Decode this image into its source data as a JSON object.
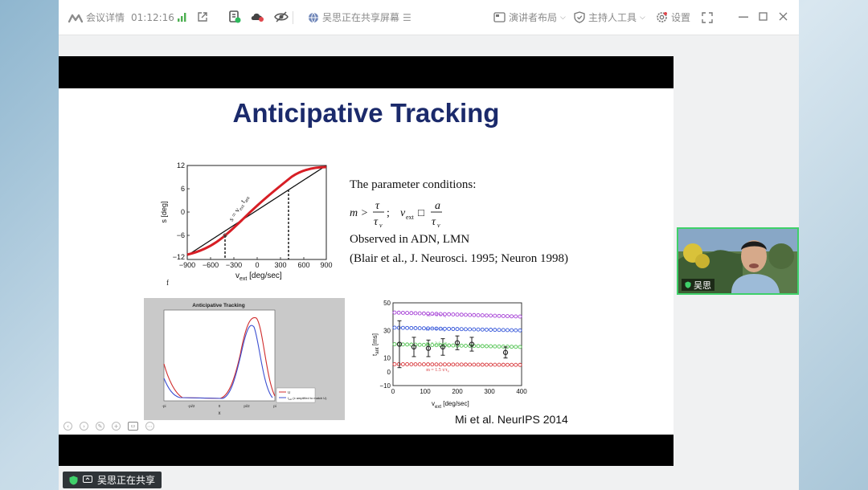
{
  "topbar": {
    "meeting_info_label": "会议详情",
    "timer": "01:12:16",
    "sharing_status": "吴思正在共享屏幕",
    "presenter_layout_label": "演讲者布局",
    "host_tools_label": "主持人工具",
    "settings_label": "设置"
  },
  "slide": {
    "title": "Anticipative Tracking",
    "param_heading": "The parameter conditions:",
    "formula_m": "m >",
    "formula_tau": "τ",
    "formula_tau_v": "τ",
    "formula_sub_v": "v",
    "formula_semicolon": ";",
    "formula_vext": "v",
    "formula_sub_ext": "ext",
    "formula_box": "□",
    "formula_a": "a",
    "formula_tau_v2": "τ",
    "formula_sub_v2": "v",
    "observed": "Observed in ADN, LMN",
    "refs": "(Blair et al., J. Neurosci. 1995; Neuron 1998)",
    "citation": "Mi et al. NeurIPS 2014"
  },
  "chart_top": {
    "y_label": "s [deg]",
    "x_label_main": "v",
    "x_label_sub": "ext",
    "x_label_unit": "[deg/sec]",
    "line_annotation": "s = v",
    "line_annotation_sub": "ext",
    "line_annotation_tail": "t",
    "line_annotation_tail_sub": "ant",
    "x_ticks": [
      "−900",
      "−600",
      "−300",
      "0",
      "300",
      "600",
      "900"
    ],
    "y_ticks": [
      "12",
      "6",
      "0",
      "−6",
      "−12"
    ],
    "stray_label": "f"
  },
  "chart_sim": {
    "title": "Anticipative Tracking",
    "legend_u": "U",
    "legend_input": "I",
    "legend_input_sub": "ext",
    "legend_input_note": "(x amplified to match U)",
    "x_ticks": [
      "-pi",
      "-pi/2",
      "0",
      "pi/2",
      "pi"
    ],
    "x_label": "x"
  },
  "chart_data": {
    "type": "scatter",
    "xlabel": "v",
    "xlabel_sub": "ext",
    "xlabel_unit": "[deg/sec]",
    "ylabel": "t",
    "ylabel_sub": "ant",
    "ylabel_unit": "[ms]",
    "xlim": [
      0,
      400
    ],
    "ylim": [
      -10,
      50
    ],
    "x_ticks": [
      "0",
      "100",
      "200",
      "300",
      "400"
    ],
    "y_ticks": [
      "50",
      "30",
      "10",
      "0",
      "−10"
    ],
    "series": [
      {
        "name": "m = 5 τ/τ",
        "name_sub": "v",
        "color": "#a53fd6",
        "y_start": 43,
        "y_end": 40
      },
      {
        "name": "m = 4 τ/τ",
        "name_sub": "v",
        "color": "#3355d9",
        "y_start": 32,
        "y_end": 30
      },
      {
        "name": "m = 2.6 τ/τ",
        "name_sub": "v",
        "color": "#4ec24e",
        "y_start": 20,
        "y_end": 18
      },
      {
        "name": "m = 1.5 τ/τ",
        "name_sub": "v",
        "color": "#d8373b",
        "y_start": 5.5,
        "y_end": 5
      }
    ],
    "errorbars": {
      "x": [
        20,
        65,
        110,
        155,
        200,
        245,
        350
      ],
      "y": [
        20,
        18,
        17,
        18,
        21,
        20,
        14
      ],
      "err": [
        17,
        7,
        6,
        6,
        5,
        5,
        4
      ],
      "color": "#222222"
    }
  },
  "slide_toolbar": {
    "icons": [
      "prev-icon",
      "next-icon",
      "pen-icon",
      "zoom-icon",
      "view-icon",
      "more-icon"
    ]
  },
  "sharing_badge": {
    "label": "吴思正在共享"
  },
  "video": {
    "name": "吴思"
  },
  "colors": {
    "accent_green": "#3fd06a",
    "title_blue": "#1b2a6b"
  }
}
